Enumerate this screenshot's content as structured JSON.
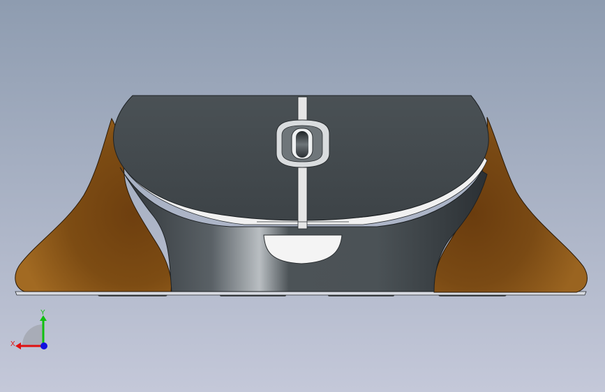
{
  "viewport": {
    "background_top": "#8e9cb0",
    "background_bottom": "#c3c8d8"
  },
  "model": {
    "shell_color": "#454b4f",
    "shell_highlight": "#6a7176",
    "grip_color": "#7a4a14",
    "grip_highlight": "#a06a25",
    "accent_color": "#f2f2f2"
  },
  "triad": {
    "x_label": "X",
    "y_label": "Y",
    "x_color": "#e01010",
    "y_color": "#10c010",
    "z_color": "#1010e0"
  }
}
